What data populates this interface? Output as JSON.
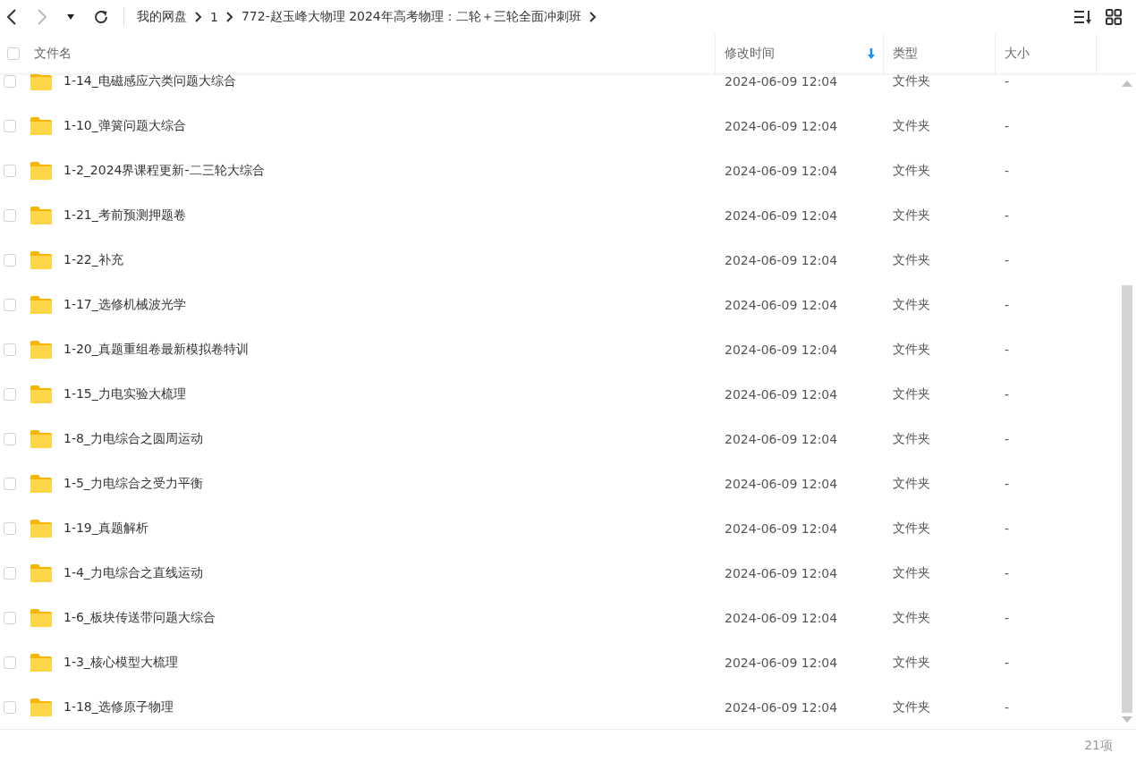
{
  "breadcrumb": [
    "我的网盘",
    "1",
    "772-赵玉峰大物理 2024年高考物理：二轮＋三轮全面冲刺班"
  ],
  "table": {
    "select_all": {
      "checked": false
    },
    "columns": [
      {
        "label": "文件名",
        "sorted": false
      },
      {
        "label": "修改时间",
        "sorted": true
      },
      {
        "label": "类型",
        "sorted": false
      },
      {
        "label": "大小",
        "sorted": false
      }
    ],
    "rows": [
      {
        "name": "1-14_电磁感应六类问题大综合",
        "modified": "2024-06-09 12:04",
        "type": "文件夹",
        "size": "-",
        "checked": false
      },
      {
        "name": "1-10_弹簧问题大综合",
        "modified": "2024-06-09 12:04",
        "type": "文件夹",
        "size": "-",
        "checked": false
      },
      {
        "name": "1-2_2024界课程更新-二三轮大综合",
        "modified": "2024-06-09 12:04",
        "type": "文件夹",
        "size": "-",
        "checked": false
      },
      {
        "name": "1-21_考前预测押题卷",
        "modified": "2024-06-09 12:04",
        "type": "文件夹",
        "size": "-",
        "checked": false
      },
      {
        "name": "1-22_补充",
        "modified": "2024-06-09 12:04",
        "type": "文件夹",
        "size": "-",
        "checked": false
      },
      {
        "name": "1-17_选修机械波光学",
        "modified": "2024-06-09 12:04",
        "type": "文件夹",
        "size": "-",
        "checked": false
      },
      {
        "name": "1-20_真题重组卷最新模拟卷特训",
        "modified": "2024-06-09 12:04",
        "type": "文件夹",
        "size": "-",
        "checked": false
      },
      {
        "name": "1-15_力电实验大梳理",
        "modified": "2024-06-09 12:04",
        "type": "文件夹",
        "size": "-",
        "checked": false
      },
      {
        "name": "1-8_力电综合之圆周运动",
        "modified": "2024-06-09 12:04",
        "type": "文件夹",
        "size": "-",
        "checked": false
      },
      {
        "name": "1-5_力电综合之受力平衡",
        "modified": "2024-06-09 12:04",
        "type": "文件夹",
        "size": "-",
        "checked": false
      },
      {
        "name": "1-19_真题解析",
        "modified": "2024-06-09 12:04",
        "type": "文件夹",
        "size": "-",
        "checked": false
      },
      {
        "name": "1-4_力电综合之直线运动",
        "modified": "2024-06-09 12:04",
        "type": "文件夹",
        "size": "-",
        "checked": false
      },
      {
        "name": "1-6_板块传送带问题大综合",
        "modified": "2024-06-09 12:04",
        "type": "文件夹",
        "size": "-",
        "checked": false
      },
      {
        "name": "1-3_核心模型大梳理",
        "modified": "2024-06-09 12:04",
        "type": "文件夹",
        "size": "-",
        "checked": false
      },
      {
        "name": "1-18_选修原子物理",
        "modified": "2024-06-09 12:04",
        "type": "文件夹",
        "size": "-",
        "checked": false
      }
    ]
  },
  "status_bar": {
    "count": "21项"
  }
}
